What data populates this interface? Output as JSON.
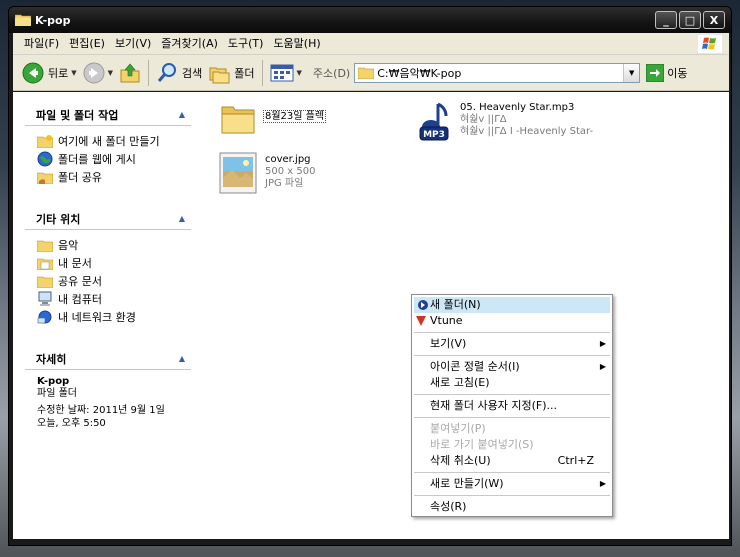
{
  "window": {
    "title": "K-pop",
    "buttons": {
      "minimize": "_",
      "maximize": "□",
      "close": "X"
    }
  },
  "menu": [
    "파일(F)",
    "편집(E)",
    "보기(V)",
    "즐겨찾기(A)",
    "도구(T)",
    "도움말(H)"
  ],
  "toolbar": {
    "back": "뒤로",
    "search": "검색",
    "folders": "폴더",
    "address_label": "주소(D)",
    "address_value": "C:₩음악₩K-pop",
    "go": "이동"
  },
  "left_pane": {
    "tasks": {
      "title": "파일 및 폴더 작업",
      "items": [
        "여기에 새 폴더 만들기",
        "폴더를 웹에 게시",
        "폴더 공유"
      ]
    },
    "places": {
      "title": "기타 위치",
      "items": [
        "음악",
        "내 문서",
        "공유 문서",
        "내 컴퓨터",
        "내 네트워크 환경"
      ]
    },
    "details": {
      "title": "자세히",
      "name": "K-pop",
      "type": "파일 폴더",
      "modified": "수정한 날짜: 2011년 9월 1일",
      "time": "오늘, 오후 5:50"
    }
  },
  "files": [
    {
      "name": "8월23일 플렉",
      "kind": "folder"
    },
    {
      "name": "05. Heavenly Star.mp3",
      "line2": "혀쉁v ||ΓΔ",
      "line3": "혀쉁v ||ΓΔ I -Heavenly Star-",
      "kind": "mp3",
      "badge": "MP3"
    },
    {
      "name": "cover.jpg",
      "line2": "500 x 500",
      "line3": "JPG 파일",
      "kind": "image"
    }
  ],
  "context_menu": {
    "new_folder": "새 폴더(N)",
    "vtune": "Vtune",
    "view": "보기(V)",
    "arrange": "아이콘 정렬 순서(I)",
    "refresh": "새로 고침(E)",
    "customize": "현재 폴더 사용자 지정(F)...",
    "paste": "붙여넣기(P)",
    "paste_shortcut": "바로 가기 붙여넣기(S)",
    "undo_delete": "삭제 취소(U)",
    "undo_shortcut": "Ctrl+Z",
    "new": "새로 만들기(W)",
    "properties": "속성(R)"
  },
  "colors": {
    "highlight": "#cde7f7",
    "pane_header_text": "#000000",
    "folder": "#f3d36a"
  }
}
